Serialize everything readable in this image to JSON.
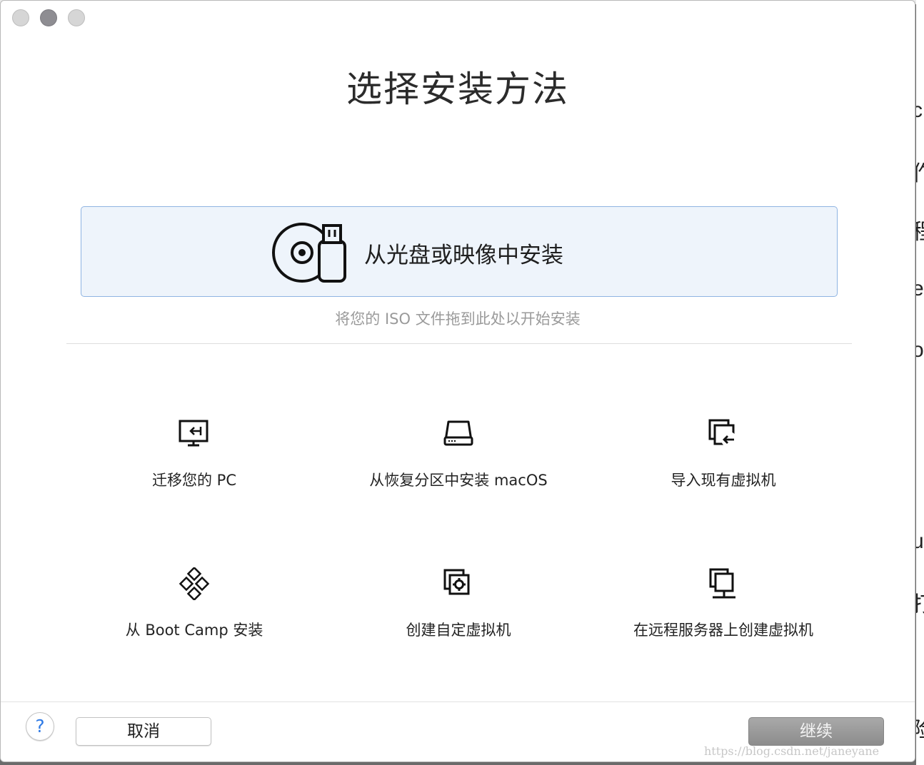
{
  "window": {
    "title": "选择安装方法"
  },
  "install_from_media": {
    "label": "从光盘或映像中安装",
    "hint": "将您的 ISO 文件拖到此处以开始安装"
  },
  "options": [
    {
      "label": "迁移您的 PC",
      "icon": "migrate-pc-icon"
    },
    {
      "label": "从恢复分区中安装 macOS",
      "icon": "drive-icon"
    },
    {
      "label": "导入现有虚拟机",
      "icon": "import-vm-icon"
    },
    {
      "label": "从 Boot Camp 安装",
      "icon": "bootcamp-icon"
    },
    {
      "label": "创建自定虚拟机",
      "icon": "custom-vm-icon"
    },
    {
      "label": "在远程服务器上创建虚拟机",
      "icon": "remote-server-icon"
    }
  ],
  "footer": {
    "help_label": "?",
    "cancel_label": "取消",
    "continue_label": "继续"
  },
  "watermark": "https://blog.csdn.net/janeyane",
  "background_app_chars": [
    "c",
    "作",
    "程",
    "e",
    "o",
    "u",
    "打",
    "险"
  ]
}
